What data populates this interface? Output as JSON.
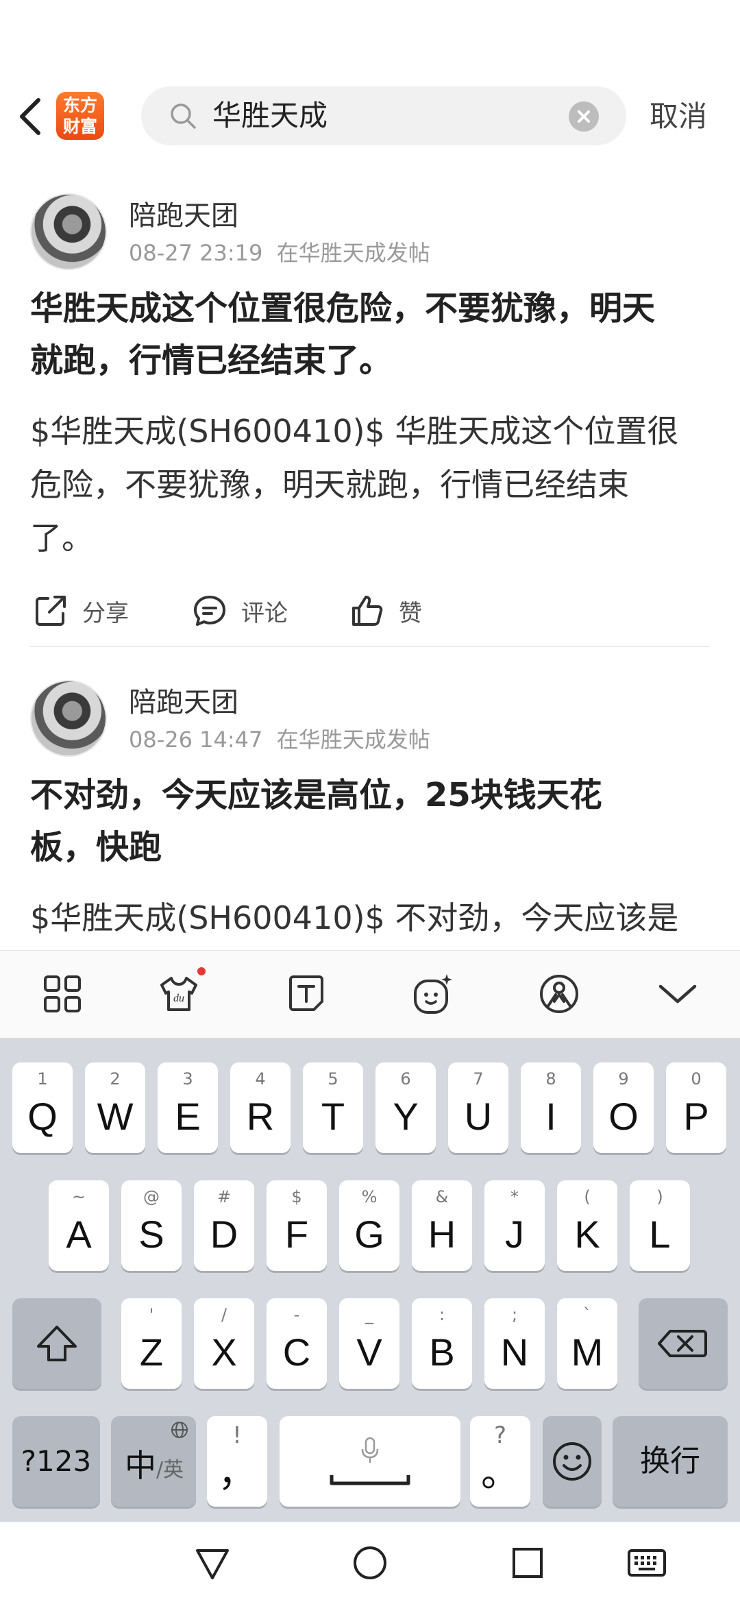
{
  "header": {
    "logo_line1": "东方",
    "logo_line2": "财富",
    "search_value": "华胜天成",
    "cancel_label": "取消"
  },
  "posts": [
    {
      "author": "陪跑天团",
      "time": "08-27 23:19",
      "location": "在华胜天成发帖",
      "title_line1": "华胜天成这个位置很危险，不要犹豫，明天",
      "title_line2": "就跑，行情已经结束了。",
      "body_line1": "$华胜天成(SH600410)$ 华胜天成这个位置很",
      "body_line2": "危险，不要犹豫，明天就跑，行情已经结束",
      "body_line3": "了。",
      "share_label": "分享",
      "comment_label": "评论",
      "like_label": "赞"
    },
    {
      "author": "陪跑天团",
      "time": "08-26 14:47",
      "location": "在华胜天成发帖",
      "title_line1": "不对劲，今天应该是高位，25块钱天花",
      "title_line2": "板，快跑",
      "body_line1": "$华胜天成(SH600410)$ 不对劲，今天应该是"
    }
  ],
  "toolbar": {
    "icons": [
      "grid-icon",
      "skin-icon",
      "text-icon",
      "emoji-face-icon",
      "voice-assistant-icon",
      "collapse-icon"
    ],
    "notification_dot_color": "#e53935"
  },
  "keyboard": {
    "row1": [
      {
        "hint": "1",
        "key": "Q"
      },
      {
        "hint": "2",
        "key": "W"
      },
      {
        "hint": "3",
        "key": "E"
      },
      {
        "hint": "4",
        "key": "R"
      },
      {
        "hint": "5",
        "key": "T"
      },
      {
        "hint": "6",
        "key": "Y"
      },
      {
        "hint": "7",
        "key": "U"
      },
      {
        "hint": "8",
        "key": "I"
      },
      {
        "hint": "9",
        "key": "O"
      },
      {
        "hint": "0",
        "key": "P"
      }
    ],
    "row2": [
      {
        "hint": "~",
        "key": "A"
      },
      {
        "hint": "@",
        "key": "S"
      },
      {
        "hint": "#",
        "key": "D"
      },
      {
        "hint": "$",
        "key": "F"
      },
      {
        "hint": "%",
        "key": "G"
      },
      {
        "hint": "&",
        "key": "H"
      },
      {
        "hint": "*",
        "key": "J"
      },
      {
        "hint": "(",
        "key": "K"
      },
      {
        "hint": ")",
        "key": "L"
      }
    ],
    "row3": [
      {
        "hint": "'",
        "key": "Z"
      },
      {
        "hint": "/",
        "key": "X"
      },
      {
        "hint": "-",
        "key": "C"
      },
      {
        "hint": "_",
        "key": "V"
      },
      {
        "hint": ":",
        "key": "B"
      },
      {
        "hint": ";",
        "key": "N"
      },
      {
        "hint": "`",
        "key": "M"
      }
    ],
    "symbols_label": "?123",
    "lang_main": "中",
    "lang_sub": "/英",
    "comma_hint": "!",
    "comma_key": "，",
    "period_hint": "?",
    "period_key": "。",
    "enter_label": "换行"
  }
}
